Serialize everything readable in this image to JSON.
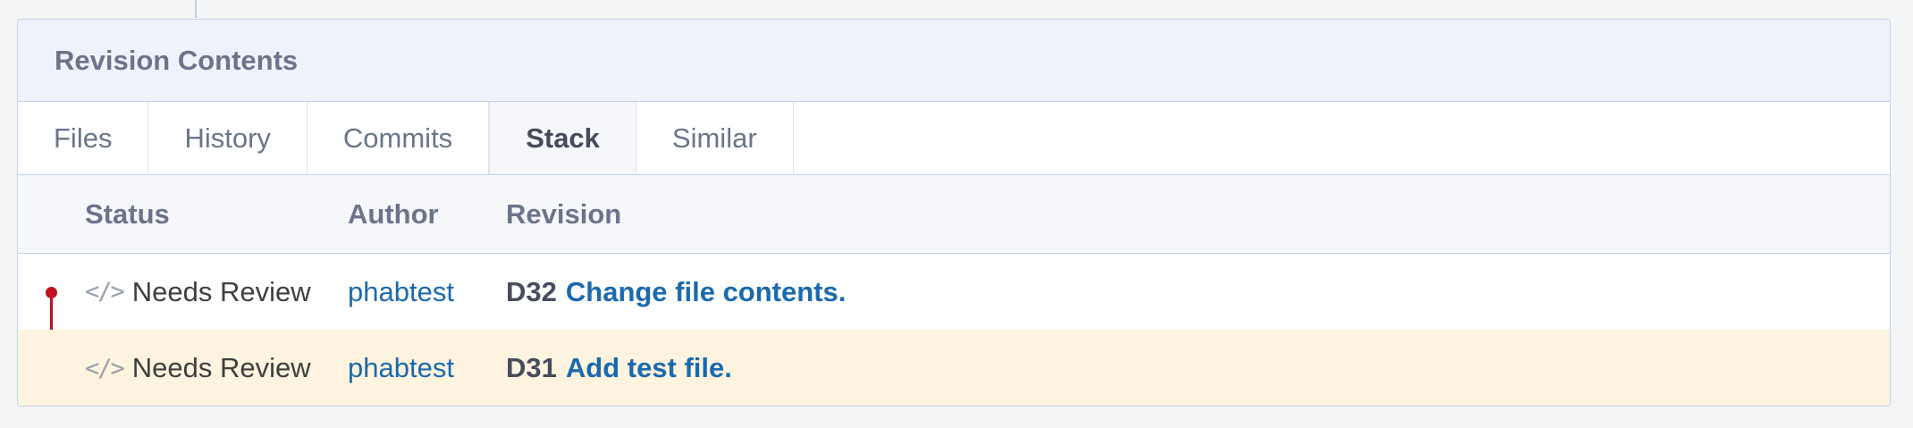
{
  "panel": {
    "title": "Revision Contents"
  },
  "tabs": [
    {
      "label": "Files",
      "active": false
    },
    {
      "label": "History",
      "active": false
    },
    {
      "label": "Commits",
      "active": false
    },
    {
      "label": "Stack",
      "active": true
    },
    {
      "label": "Similar",
      "active": false
    }
  ],
  "table": {
    "columns": [
      "Status",
      "Author",
      "Revision"
    ],
    "rows": [
      {
        "status_icon": "code-icon",
        "status_icon_glyph": "</>",
        "status": "Needs Review",
        "author": "phabtest",
        "revision_id": "D32",
        "revision_title": "Change file contents.",
        "current": false
      },
      {
        "status_icon": "code-icon",
        "status_icon_glyph": "</>",
        "status": "Needs Review",
        "author": "phabtest",
        "revision_id": "D31",
        "revision_title": "Add test file.",
        "current": true
      }
    ]
  },
  "colors": {
    "link": "#1a6aad",
    "graph": "#c0111f",
    "current_row": "#fdf3df",
    "header_bg": "#eef3fb"
  }
}
